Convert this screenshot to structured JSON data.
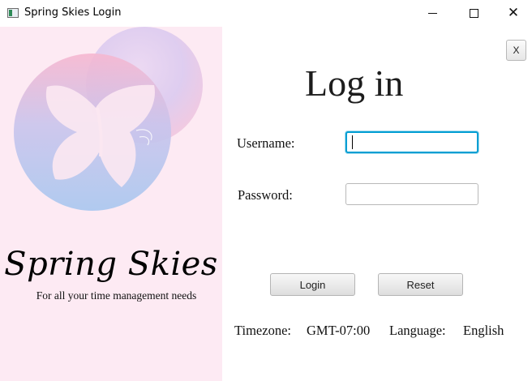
{
  "window": {
    "title": "Spring Skies Login",
    "icon": "app-window-icon",
    "controls": {
      "minimize": "minimize-icon",
      "maximize": "maximize-icon",
      "close": "✕"
    }
  },
  "brand": {
    "name": "Spring Skies",
    "tagline": "For all your time management needs",
    "logo": "butterfly-logo",
    "colors": {
      "panel": "#fdeaf3",
      "pink": "#f7b3cf",
      "blue": "#a9c8ee",
      "lavender": "#d8c6ee"
    }
  },
  "dialog": {
    "close_button_label": "X",
    "title": "Log in"
  },
  "form": {
    "username_label": "Username:",
    "username_value": "",
    "password_label": "Password:",
    "password_value": "",
    "focus_color": "#039ed3"
  },
  "buttons": {
    "login_label": "Login",
    "reset_label": "Reset"
  },
  "footer": {
    "timezone_label": "Timezone:",
    "timezone_value": "GMT-07:00",
    "language_label": "Language:",
    "language_value": "English"
  }
}
